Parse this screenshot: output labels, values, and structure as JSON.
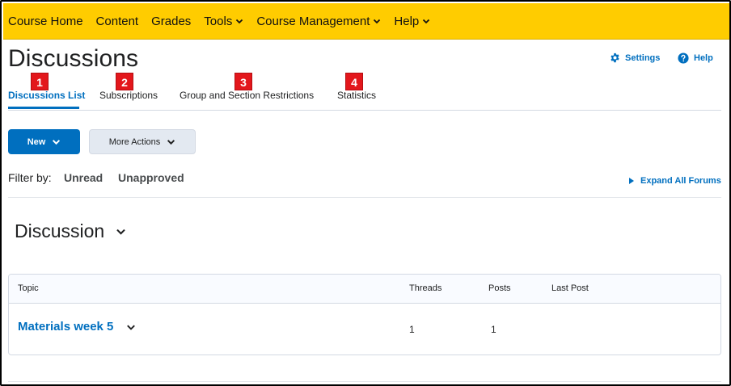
{
  "nav": {
    "items": [
      {
        "label": "Course Home",
        "dropdown": false
      },
      {
        "label": "Content",
        "dropdown": false
      },
      {
        "label": "Grades",
        "dropdown": false
      },
      {
        "label": "Tools",
        "dropdown": true
      },
      {
        "label": "Course Management",
        "dropdown": true
      },
      {
        "label": "Help",
        "dropdown": true
      }
    ],
    "color": "#ffcc00"
  },
  "header": {
    "title": "Discussions",
    "settings_label": "Settings",
    "help_label": "Help"
  },
  "tabs": [
    {
      "label": "Discussions List",
      "badge": "1",
      "active": true
    },
    {
      "label": "Subscriptions",
      "badge": "2",
      "active": false
    },
    {
      "label": "Group and Section Restrictions",
      "badge": "3",
      "active": false
    },
    {
      "label": "Statistics",
      "badge": "4",
      "active": false
    }
  ],
  "actions": {
    "new_label": "New",
    "more_actions_label": "More Actions"
  },
  "filter": {
    "label": "Filter by:",
    "options": [
      "Unread",
      "Unapproved"
    ],
    "expand_label": "Expand All Forums"
  },
  "forum": {
    "title": "Discussion",
    "columns": [
      "Topic",
      "Threads",
      "Posts",
      "Last Post"
    ],
    "rows": [
      {
        "topic": "Materials week 5",
        "threads": "1",
        "posts": "1",
        "last_post": ""
      }
    ]
  },
  "colors": {
    "accent": "#006fbf",
    "badge": "#e3171c"
  },
  "icons": {
    "settings": "gear-icon",
    "help": "help-circle-icon",
    "dropdown": "chevron-down-icon",
    "expand": "triangle-right-icon"
  }
}
